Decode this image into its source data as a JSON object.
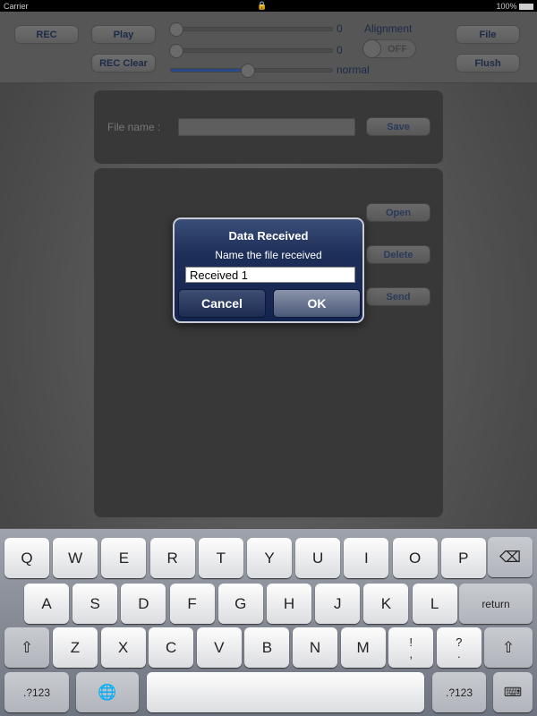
{
  "status": {
    "carrier": "Carrier",
    "battery": "100%"
  },
  "toolbar": {
    "rec": "REC",
    "play": "Play",
    "rec_clear": "REC Clear",
    "file": "File",
    "flush": "Flush",
    "slider1_value": "0",
    "slider2_value": "0",
    "speed_value": "normal",
    "speed_level": 0.47,
    "alignment_label": "Alignment",
    "alignment_toggle": "OFF"
  },
  "file_panel": {
    "file_name_label": "File name :",
    "file_name_value": "",
    "save": "Save"
  },
  "list_panel": {
    "open": "Open",
    "delete": "Delete",
    "send": "Send"
  },
  "alert": {
    "title": "Data Received",
    "message": "Name the file received",
    "input_value": "Received 1",
    "cancel": "Cancel",
    "ok": "OK"
  },
  "keyboard": {
    "row1": [
      "Q",
      "W",
      "E",
      "R",
      "T",
      "Y",
      "U",
      "I",
      "O",
      "P"
    ],
    "row2": [
      "A",
      "S",
      "D",
      "F",
      "G",
      "H",
      "J",
      "K",
      "L"
    ],
    "row3": [
      "Z",
      "X",
      "C",
      "V",
      "B",
      "N",
      "M",
      "!\n,",
      "?\n."
    ],
    "return": "return",
    "numbers": ".?123"
  },
  "colors": {
    "alert_bg": "#1d2e58",
    "accent_slider": "#2a4a8a",
    "button_text": "#1c2a48"
  }
}
